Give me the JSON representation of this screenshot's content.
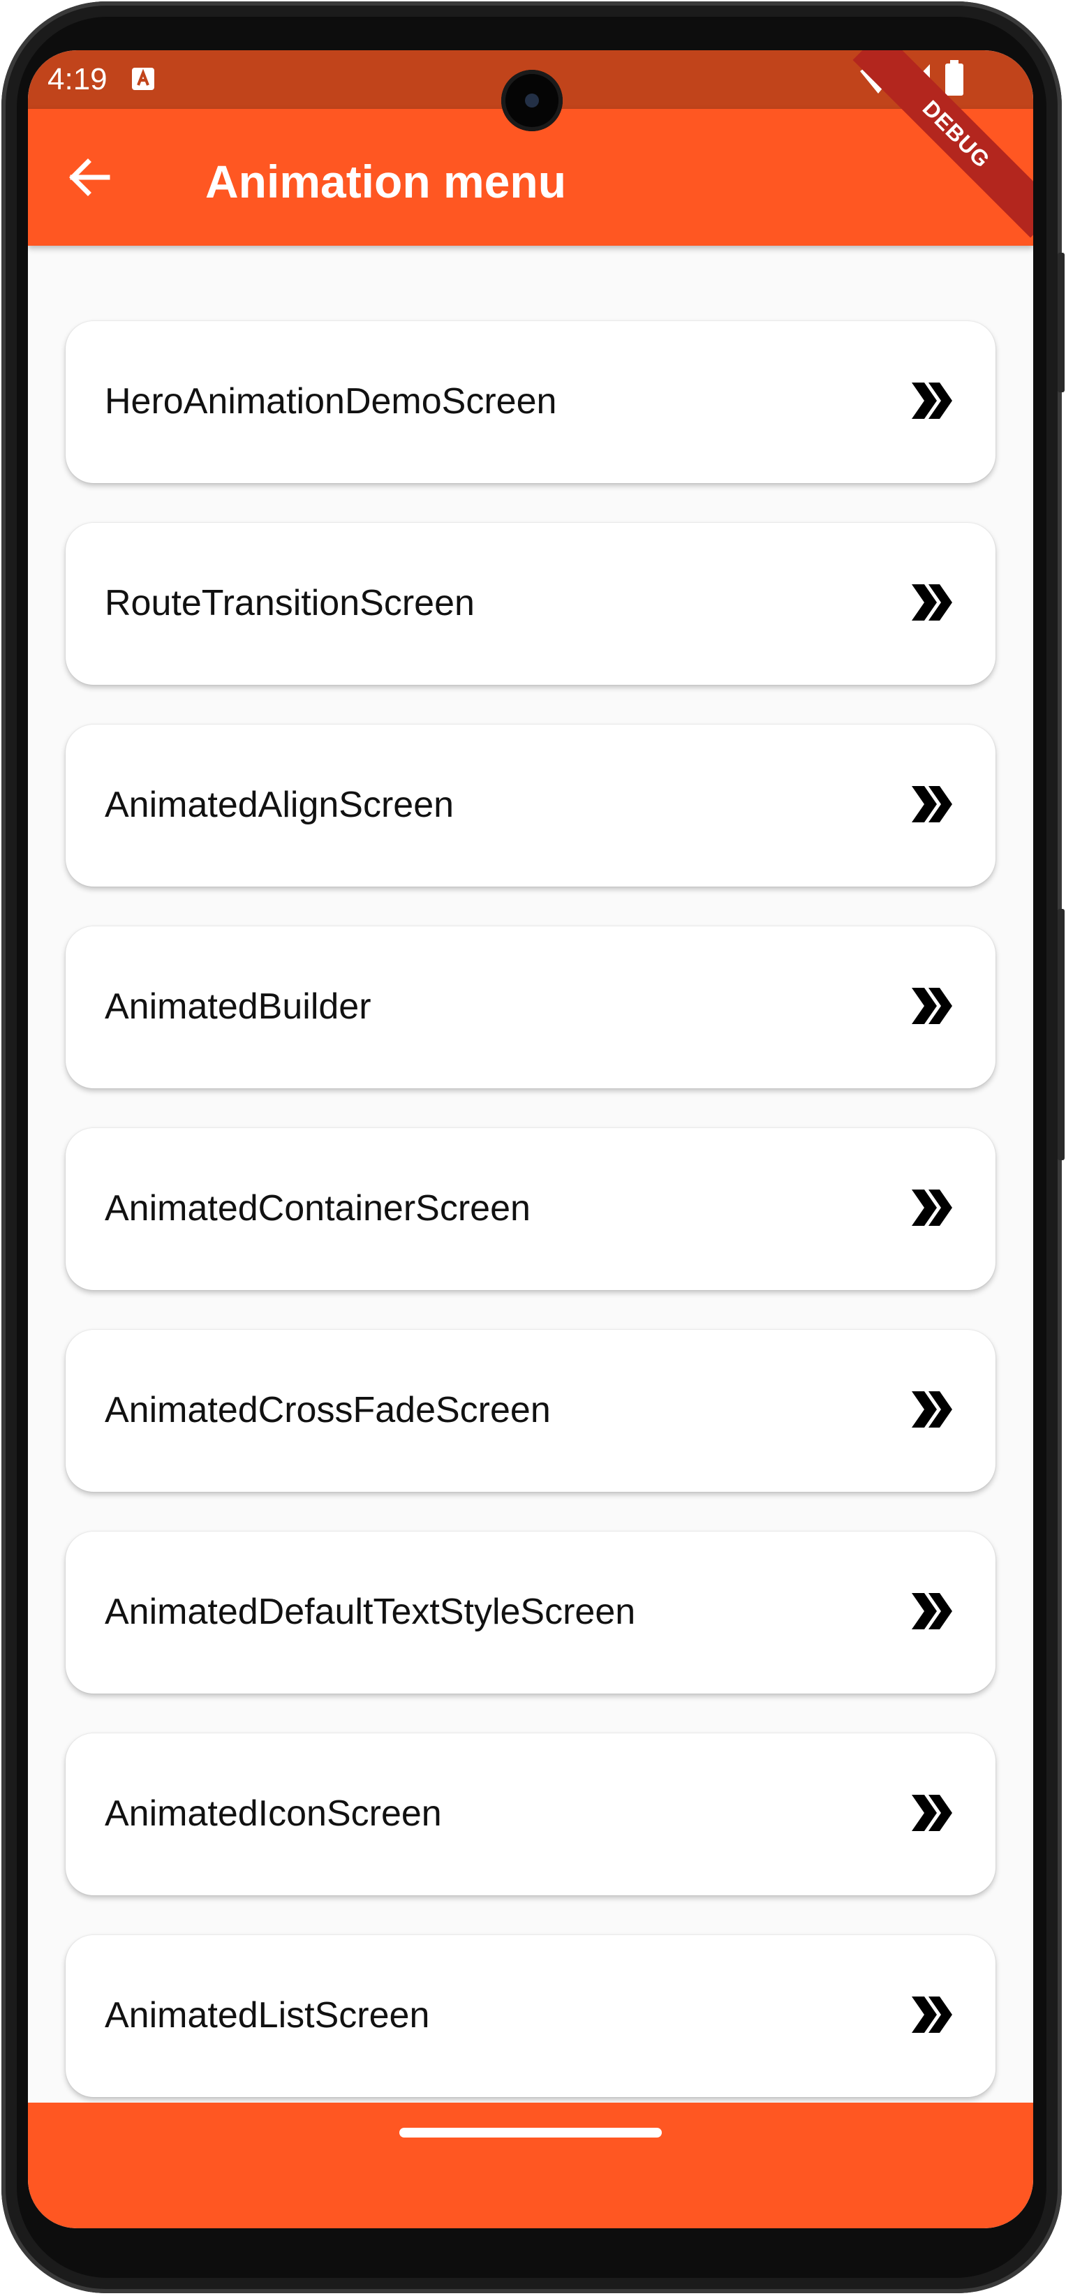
{
  "status_bar": {
    "time": "4:19",
    "background": "#c1441b",
    "debug_label": "DEBUG"
  },
  "app_bar": {
    "title": "Animation menu",
    "back_icon": "arrow-left-icon",
    "color": "#ff5722"
  },
  "menu": {
    "trailing_icon": "double-chevron-right-icon",
    "items": [
      {
        "label": "HeroAnimationDemoScreen"
      },
      {
        "label": "RouteTransitionScreen"
      },
      {
        "label": "AnimatedAlignScreen"
      },
      {
        "label": "AnimatedBuilder"
      },
      {
        "label": "AnimatedContainerScreen"
      },
      {
        "label": "AnimatedCrossFadeScreen"
      },
      {
        "label": "AnimatedDefaultTextStyleScreen"
      },
      {
        "label": "AnimatedIconScreen"
      },
      {
        "label": "AnimatedListScreen"
      },
      {
        "label": ""
      }
    ]
  }
}
